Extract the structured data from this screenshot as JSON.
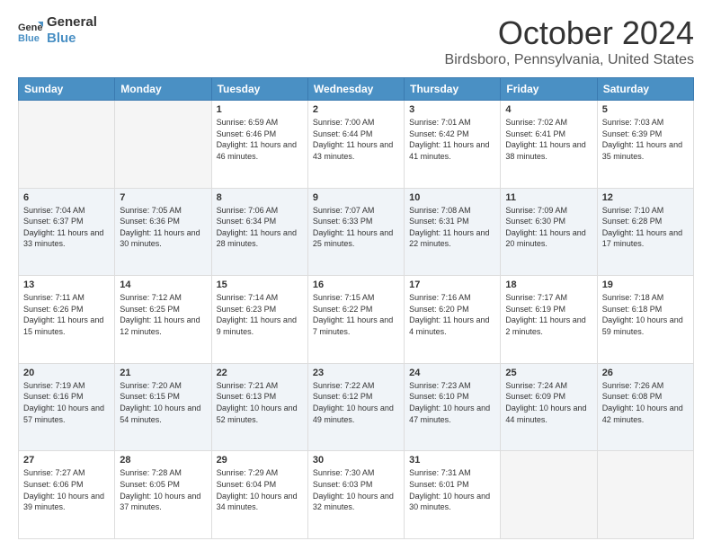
{
  "logo": {
    "line1": "General",
    "line2": "Blue"
  },
  "title": "October 2024",
  "subtitle": "Birdsboro, Pennsylvania, United States",
  "headers": [
    "Sunday",
    "Monday",
    "Tuesday",
    "Wednesday",
    "Thursday",
    "Friday",
    "Saturday"
  ],
  "weeks": [
    [
      {
        "day": "",
        "info": ""
      },
      {
        "day": "",
        "info": ""
      },
      {
        "day": "1",
        "info": "Sunrise: 6:59 AM\nSunset: 6:46 PM\nDaylight: 11 hours and 46 minutes."
      },
      {
        "day": "2",
        "info": "Sunrise: 7:00 AM\nSunset: 6:44 PM\nDaylight: 11 hours and 43 minutes."
      },
      {
        "day": "3",
        "info": "Sunrise: 7:01 AM\nSunset: 6:42 PM\nDaylight: 11 hours and 41 minutes."
      },
      {
        "day": "4",
        "info": "Sunrise: 7:02 AM\nSunset: 6:41 PM\nDaylight: 11 hours and 38 minutes."
      },
      {
        "day": "5",
        "info": "Sunrise: 7:03 AM\nSunset: 6:39 PM\nDaylight: 11 hours and 35 minutes."
      }
    ],
    [
      {
        "day": "6",
        "info": "Sunrise: 7:04 AM\nSunset: 6:37 PM\nDaylight: 11 hours and 33 minutes."
      },
      {
        "day": "7",
        "info": "Sunrise: 7:05 AM\nSunset: 6:36 PM\nDaylight: 11 hours and 30 minutes."
      },
      {
        "day": "8",
        "info": "Sunrise: 7:06 AM\nSunset: 6:34 PM\nDaylight: 11 hours and 28 minutes."
      },
      {
        "day": "9",
        "info": "Sunrise: 7:07 AM\nSunset: 6:33 PM\nDaylight: 11 hours and 25 minutes."
      },
      {
        "day": "10",
        "info": "Sunrise: 7:08 AM\nSunset: 6:31 PM\nDaylight: 11 hours and 22 minutes."
      },
      {
        "day": "11",
        "info": "Sunrise: 7:09 AM\nSunset: 6:30 PM\nDaylight: 11 hours and 20 minutes."
      },
      {
        "day": "12",
        "info": "Sunrise: 7:10 AM\nSunset: 6:28 PM\nDaylight: 11 hours and 17 minutes."
      }
    ],
    [
      {
        "day": "13",
        "info": "Sunrise: 7:11 AM\nSunset: 6:26 PM\nDaylight: 11 hours and 15 minutes."
      },
      {
        "day": "14",
        "info": "Sunrise: 7:12 AM\nSunset: 6:25 PM\nDaylight: 11 hours and 12 minutes."
      },
      {
        "day": "15",
        "info": "Sunrise: 7:14 AM\nSunset: 6:23 PM\nDaylight: 11 hours and 9 minutes."
      },
      {
        "day": "16",
        "info": "Sunrise: 7:15 AM\nSunset: 6:22 PM\nDaylight: 11 hours and 7 minutes."
      },
      {
        "day": "17",
        "info": "Sunrise: 7:16 AM\nSunset: 6:20 PM\nDaylight: 11 hours and 4 minutes."
      },
      {
        "day": "18",
        "info": "Sunrise: 7:17 AM\nSunset: 6:19 PM\nDaylight: 11 hours and 2 minutes."
      },
      {
        "day": "19",
        "info": "Sunrise: 7:18 AM\nSunset: 6:18 PM\nDaylight: 10 hours and 59 minutes."
      }
    ],
    [
      {
        "day": "20",
        "info": "Sunrise: 7:19 AM\nSunset: 6:16 PM\nDaylight: 10 hours and 57 minutes."
      },
      {
        "day": "21",
        "info": "Sunrise: 7:20 AM\nSunset: 6:15 PM\nDaylight: 10 hours and 54 minutes."
      },
      {
        "day": "22",
        "info": "Sunrise: 7:21 AM\nSunset: 6:13 PM\nDaylight: 10 hours and 52 minutes."
      },
      {
        "day": "23",
        "info": "Sunrise: 7:22 AM\nSunset: 6:12 PM\nDaylight: 10 hours and 49 minutes."
      },
      {
        "day": "24",
        "info": "Sunrise: 7:23 AM\nSunset: 6:10 PM\nDaylight: 10 hours and 47 minutes."
      },
      {
        "day": "25",
        "info": "Sunrise: 7:24 AM\nSunset: 6:09 PM\nDaylight: 10 hours and 44 minutes."
      },
      {
        "day": "26",
        "info": "Sunrise: 7:26 AM\nSunset: 6:08 PM\nDaylight: 10 hours and 42 minutes."
      }
    ],
    [
      {
        "day": "27",
        "info": "Sunrise: 7:27 AM\nSunset: 6:06 PM\nDaylight: 10 hours and 39 minutes."
      },
      {
        "day": "28",
        "info": "Sunrise: 7:28 AM\nSunset: 6:05 PM\nDaylight: 10 hours and 37 minutes."
      },
      {
        "day": "29",
        "info": "Sunrise: 7:29 AM\nSunset: 6:04 PM\nDaylight: 10 hours and 34 minutes."
      },
      {
        "day": "30",
        "info": "Sunrise: 7:30 AM\nSunset: 6:03 PM\nDaylight: 10 hours and 32 minutes."
      },
      {
        "day": "31",
        "info": "Sunrise: 7:31 AM\nSunset: 6:01 PM\nDaylight: 10 hours and 30 minutes."
      },
      {
        "day": "",
        "info": ""
      },
      {
        "day": "",
        "info": ""
      }
    ]
  ]
}
